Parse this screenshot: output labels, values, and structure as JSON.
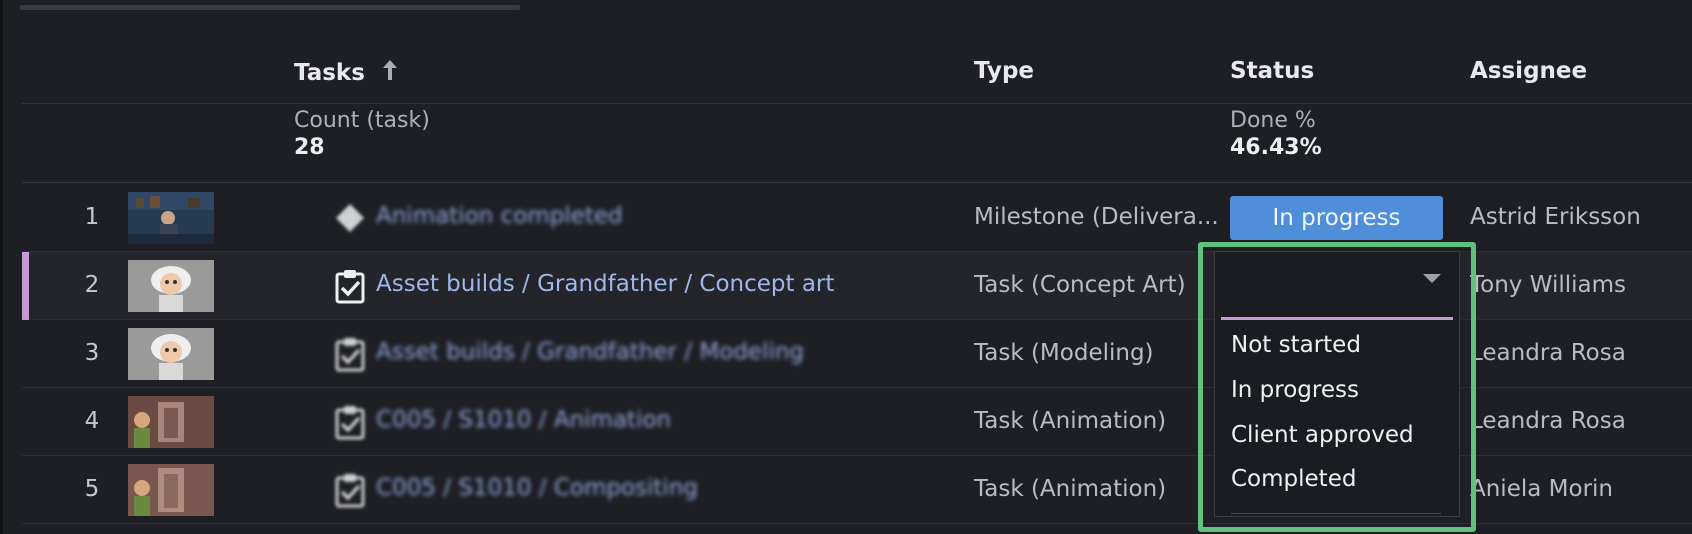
{
  "header": {
    "tasks": "Tasks",
    "type": "Type",
    "status": "Status",
    "assignee": "Assignee"
  },
  "aggregates": {
    "count_label": "Count (task)",
    "count_value": "28",
    "done_label": "Done %",
    "done_value": "46.43%"
  },
  "rows": [
    {
      "num": "1",
      "task": "Animation completed",
      "type": "Milestone (Delivera...",
      "status": "In progress",
      "assignee": "Astrid Eriksson",
      "icon": "milestone-diamond-icon"
    },
    {
      "num": "2",
      "task": "Asset builds / Grandfather / Concept art",
      "type": "Task (Concept Art)",
      "status": "",
      "assignee": "Tony Williams",
      "icon": "task-clipboard-icon"
    },
    {
      "num": "3",
      "task": "Asset builds / Grandfather / Modeling",
      "type": "Task (Modeling)",
      "status": "",
      "assignee": "Leandra Rosa",
      "icon": "task-clipboard-icon"
    },
    {
      "num": "4",
      "task": "C005 / S1010 / Animation",
      "type": "Task (Animation)",
      "status": "",
      "assignee": "Leandra Rosa",
      "icon": "task-clipboard-icon"
    },
    {
      "num": "5",
      "task": "C005 / S1010 / Compositing",
      "type": "Task (Animation)",
      "status": "",
      "assignee": "Aniela Morin",
      "icon": "task-clipboard-icon"
    }
  ],
  "status_dropdown": {
    "value": "",
    "options": [
      "Not started",
      "In progress",
      "Client approved",
      "Completed"
    ]
  },
  "colors": {
    "accent_selected": "#c49bd3",
    "in_progress": "#4f8fda",
    "focus_highlight": "#5fc37d",
    "link": "#9fb7ea"
  }
}
